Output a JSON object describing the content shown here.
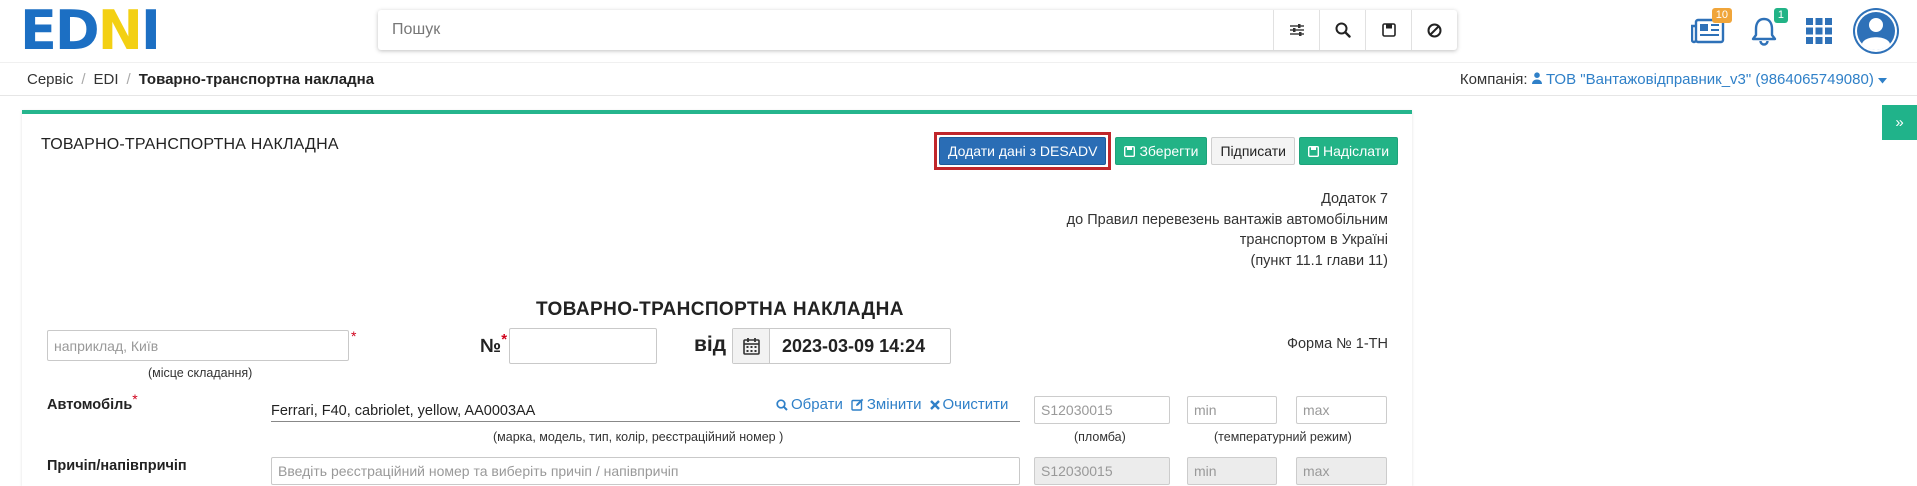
{
  "logo": {
    "letters": [
      "E",
      "D",
      "N",
      "I"
    ]
  },
  "search": {
    "placeholder": "Пошук"
  },
  "header": {
    "news_badge": "10",
    "notifications_badge": "1"
  },
  "breadcrumb": [
    "Сервіс",
    "EDI",
    "Товарно-транспортна накладна"
  ],
  "company": {
    "label": "Компанія:",
    "value": "ТОВ \"Вантажовідправник_v3\" (9864065749080)"
  },
  "panel": {
    "title": "ТОВАРНО-ТРАНСПОРТНА НАКЛАДНА",
    "buttons": {
      "desadv": "Додати дані з DESADV",
      "save": "Зберегти",
      "sign": "Підписати",
      "send": "Надіслати"
    },
    "note": [
      "Додаток 7",
      "до Правил перевезень вантажів автомобільним",
      "транспортом в Україні",
      "(пункт 11.1 глави 11)"
    ],
    "doc_title": "ТОВАРНО-ТРАНСПОРТНА НАКЛАДНА",
    "place": {
      "placeholder": "наприклад, Київ",
      "caption": "(місце складання)"
    },
    "number": {
      "label": "№",
      "value": ""
    },
    "date": {
      "label": "від",
      "value": "2023-03-09 14:24"
    },
    "form": "Форма № 1-ТН",
    "car": {
      "label": "Автомобіль",
      "value": "Ferrari, F40, cabriolet, yellow, AA0003AA",
      "caption": "(марка, модель, тип, колір, реєстраційний номер )",
      "actions": {
        "select": "Обрати",
        "edit": "Змінити",
        "clear": "Очистити"
      },
      "seal_placeholder": "S12030015",
      "seal_caption": "(пломба)",
      "temp_min": "min",
      "temp_max": "max",
      "temp_caption": "(температурний режим)"
    },
    "trailer": {
      "label": "Причіп/напівпричіп",
      "placeholder": "Введіть реєстраційний номер та виберіть причіп / напівпричіп",
      "seal_placeholder": "S12030015",
      "temp_min": "min",
      "temp_max": "max"
    }
  },
  "colors": {
    "accent_green": "#25b58d",
    "primary_blue": "#2a6db5",
    "highlight_red": "#c0262b"
  }
}
